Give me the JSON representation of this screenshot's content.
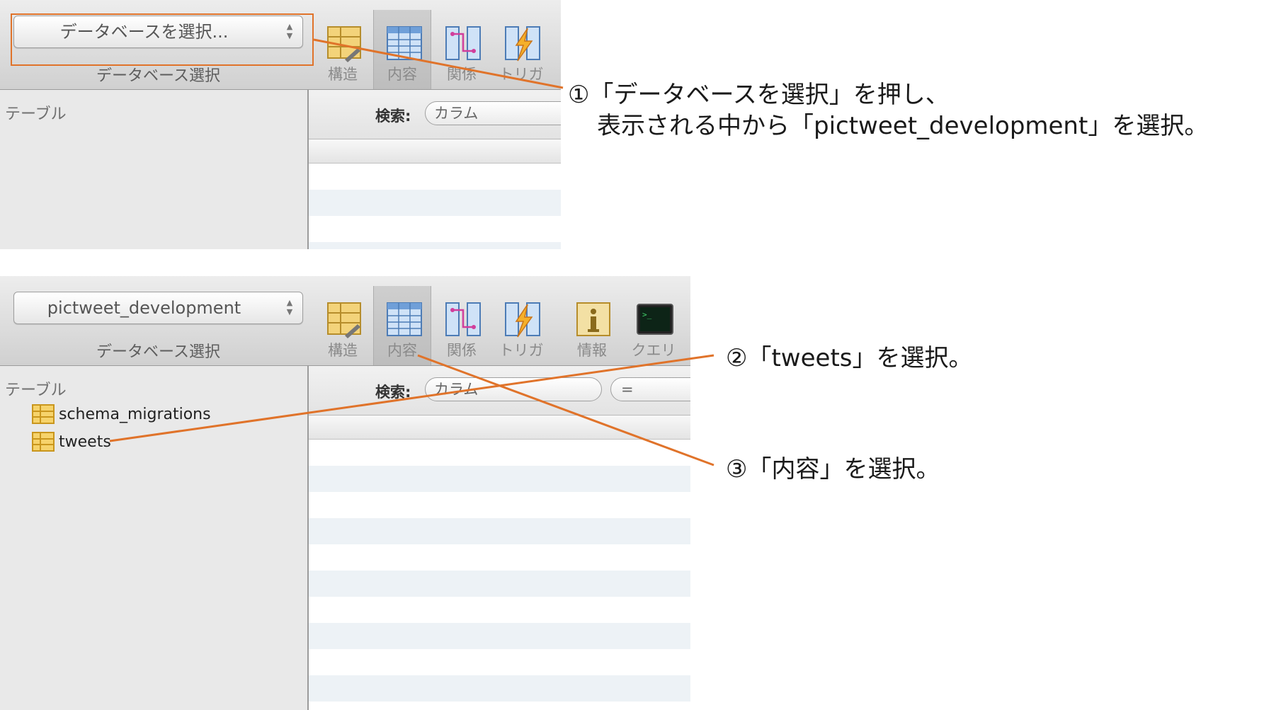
{
  "panel_top": {
    "db_select": {
      "value": "データベースを選択...",
      "caption": "データベース選択"
    },
    "toolbar": [
      "構造",
      "内容",
      "関係",
      "トリガ"
    ],
    "sidebar_title": "テーブル",
    "search_label": "検索:",
    "column_select": "カラム"
  },
  "panel_bottom": {
    "db_select": {
      "value": "pictweet_development",
      "caption": "データベース選択"
    },
    "toolbar": [
      "構造",
      "内容",
      "関係",
      "トリガ",
      "情報",
      "クエリ"
    ],
    "sidebar_title": "テーブル",
    "tables": [
      "schema_migrations",
      "tweets"
    ],
    "search_label": "検索:",
    "column_select": "カラム",
    "operator_select": "="
  },
  "annotations": {
    "step1_line1": "①「データベースを選択」を押し、",
    "step1_line2": "表示される中から「pictweet_development」を選択。",
    "step2": "②「tweets」を選択。",
    "step3": "③「内容」を選択。"
  },
  "colors": {
    "annotation_line": "#e0732a",
    "row_stripe": "#edf2f6",
    "table_icon": "#f2c23c"
  },
  "icons": [
    "table-structure-icon",
    "table-content-icon",
    "relations-icon",
    "triggers-icon",
    "info-icon",
    "query-console-icon",
    "table-icon",
    "popup-arrows-icon"
  ]
}
